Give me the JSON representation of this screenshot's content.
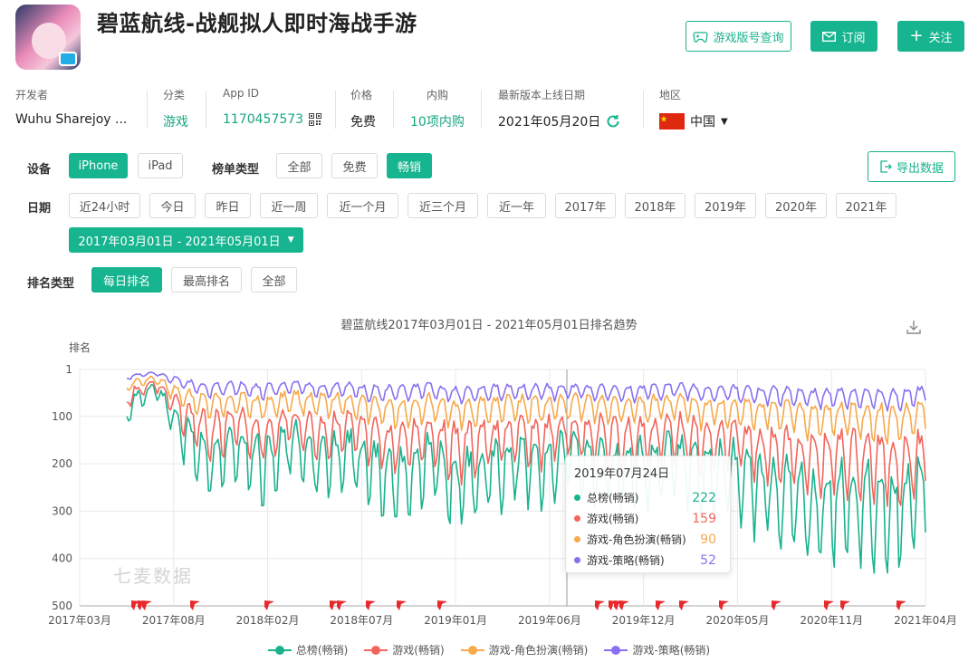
{
  "app": {
    "title": "碧蓝航线-战舰拟人即时海战手游"
  },
  "header_buttons": {
    "version_query": "游戏版号查询",
    "subscribe": "订阅",
    "follow": "关注"
  },
  "meta": {
    "developer": {
      "label": "开发者",
      "value": "Wuhu Sharejoy ..."
    },
    "category": {
      "label": "分类",
      "value": "游戏"
    },
    "app_id": {
      "label": "App ID",
      "value": "1170457573"
    },
    "price": {
      "label": "价格",
      "value": "免费"
    },
    "iap": {
      "label": "内购",
      "value": "10项内购"
    },
    "release": {
      "label": "最新版本上线日期",
      "value": "2021年05月20日"
    },
    "region": {
      "label": "地区",
      "value": "中国"
    }
  },
  "filters": {
    "device_label": "设备",
    "devices": [
      "iPhone",
      "iPad"
    ],
    "chart_type_label": "榜单类型",
    "chart_types": [
      "全部",
      "免费",
      "畅销"
    ],
    "export_label": "导出数据",
    "date_label": "日期",
    "dates": [
      "近24小时",
      "今日",
      "昨日",
      "近一周",
      "近一个月",
      "近三个月",
      "近一年",
      "2017年",
      "2018年",
      "2019年",
      "2020年",
      "2021年"
    ],
    "date_range": "2017年03月01日 - 2021年05月01日",
    "rank_type_label": "排名类型",
    "rank_types": [
      "每日排名",
      "最高排名",
      "全部"
    ]
  },
  "watermark": "七麦数据",
  "tooltip": {
    "date": "2019年07月24日",
    "rows": [
      {
        "name": "总榜(畅销)",
        "value": "222",
        "color": "#19b38e"
      },
      {
        "name": "游戏(畅销)",
        "value": "159",
        "color": "#f2655c"
      },
      {
        "name": "游戏-角色扮演(畅销)",
        "value": "90",
        "color": "#f7a94b"
      },
      {
        "name": "游戏-策略(畅销)",
        "value": "52",
        "color": "#8a70f0"
      }
    ]
  },
  "chart_data": {
    "type": "line",
    "title": "碧蓝航线2017年03月01日 - 2021年05月01日排名趋势",
    "ylabel": "排名",
    "y_inverted": true,
    "ylim": [
      1,
      500
    ],
    "y_ticks": [
      "1",
      "100",
      "200",
      "300",
      "400",
      "500"
    ],
    "x_ticks": [
      "2017年03月",
      "2017年08月",
      "2018年02月",
      "2018年07月",
      "2019年01月",
      "2019年06月",
      "2019年12月",
      "2020年05月",
      "2020年11月",
      "2021年04月"
    ],
    "grid": true,
    "legend_position": "bottom",
    "series": [
      {
        "name": "总榜(畅销)",
        "color": "#19b38e",
        "approx_profile": [
          100,
          45,
          160,
          230,
          200,
          250,
          180,
          240,
          210,
          260,
          280,
          230,
          300,
          260,
          240,
          250,
          222,
          230,
          260,
          250,
          230,
          270,
          260,
          300,
          320,
          360,
          330,
          340,
          360,
          300
        ]
      },
      {
        "name": "游戏(畅销)",
        "color": "#f2655c",
        "approx_profile": [
          70,
          35,
          110,
          160,
          140,
          170,
          130,
          165,
          150,
          180,
          190,
          160,
          200,
          180,
          170,
          175,
          159,
          165,
          180,
          170,
          160,
          190,
          180,
          200,
          210,
          230,
          220,
          230,
          240,
          210
        ]
      },
      {
        "name": "游戏-角色扮演(畅销)",
        "color": "#f7a94b",
        "approx_profile": [
          40,
          25,
          70,
          90,
          80,
          95,
          75,
          90,
          85,
          100,
          105,
          90,
          110,
          100,
          95,
          98,
          90,
          92,
          100,
          95,
          90,
          105,
          100,
          110,
          115,
          125,
          120,
          125,
          130,
          115
        ]
      },
      {
        "name": "游戏-策略(畅销)",
        "color": "#8a70f0",
        "approx_profile": [
          20,
          10,
          35,
          50,
          45,
          55,
          40,
          52,
          48,
          58,
          60,
          50,
          65,
          58,
          54,
          56,
          52,
          54,
          58,
          55,
          50,
          60,
          58,
          62,
          65,
          70,
          68,
          70,
          72,
          62
        ]
      }
    ],
    "version_flag_markers": 25
  }
}
